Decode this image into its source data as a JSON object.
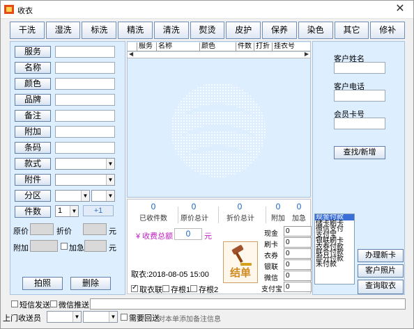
{
  "window": {
    "title": "收衣",
    "close_glyph": "✕"
  },
  "tabs": [
    "干洗",
    "湿洗",
    "标洗",
    "精洗",
    "清洗",
    "熨烫",
    "皮护",
    "保养",
    "染色",
    "其它",
    "修补"
  ],
  "left": {
    "field_buttons": [
      "服务",
      "名称",
      "颜色",
      "品牌",
      "备注",
      "附加",
      "条码",
      "款式",
      "附件",
      "分区",
      "件数"
    ],
    "count_value": "1",
    "plus_one_label": "+1",
    "original_price_label": "原价",
    "discount_price_label": "折价",
    "yuan_unit": "元",
    "extra_label": "附加",
    "urgent_label": "加急",
    "photo_button": "拍照",
    "delete_button": "删除"
  },
  "grid": {
    "columns": [
      "服务",
      "名称",
      "颜色",
      "件数",
      "打折",
      "挂衣号"
    ],
    "scroll_left": "◀",
    "scroll_right": "▶"
  },
  "summary": {
    "received_count_value": "0",
    "received_count_label": "已收件数",
    "original_total_value": "0",
    "original_total_label": "原价总计",
    "discount_total_value": "0",
    "discount_total_label": "折价总计",
    "extra_value": "0",
    "extra_label": "附加",
    "urgent_value": "0",
    "urgent_label": "加急",
    "charge_label": "¥ 收费总额",
    "charge_value": "0",
    "charge_unit": "元",
    "pickup_date": "取衣:2018-08-05 15:00",
    "settle_label": "结单",
    "receipt_options": [
      {
        "label": "取衣联",
        "checked": true
      },
      {
        "label": "存根1",
        "checked": false
      },
      {
        "label": "存根2",
        "checked": false
      }
    ],
    "payments": [
      {
        "label": "现金",
        "value": "0"
      },
      {
        "label": "刷卡",
        "value": "0"
      },
      {
        "label": "衣券",
        "value": "0"
      },
      {
        "label": "银联",
        "value": "0"
      },
      {
        "label": "微信",
        "value": "0"
      },
      {
        "label": "支付宝",
        "value": "0"
      }
    ]
  },
  "right": {
    "customer_name_label": "客户姓名",
    "customer_phone_label": "客户电话",
    "member_card_label": "会员卡号",
    "search_button": "查找/新增",
    "payment_methods": [
      "现金付款",
      "储卡刷卡",
      "微信支付",
      "支付宝",
      "银联刷卡",
      "衣券付款",
      "联合付款",
      "部分付款",
      "未付款"
    ],
    "new_card_button": "办理新卡",
    "customer_photo_button": "客户照片",
    "history_button": "查询取衣"
  },
  "bottom": {
    "sms_label": "短信发送",
    "wechat_label": "微信推送",
    "home_pickup_label": "上门收送员",
    "need_return_label": "需要回送",
    "remark_hint": "对本单添加备注信息"
  },
  "colors": {
    "panel_bg": "#ddeeff",
    "accent_blue": "#1a63c4",
    "charge_magenta": "#c020c0",
    "selection": "#3a6fd8"
  }
}
